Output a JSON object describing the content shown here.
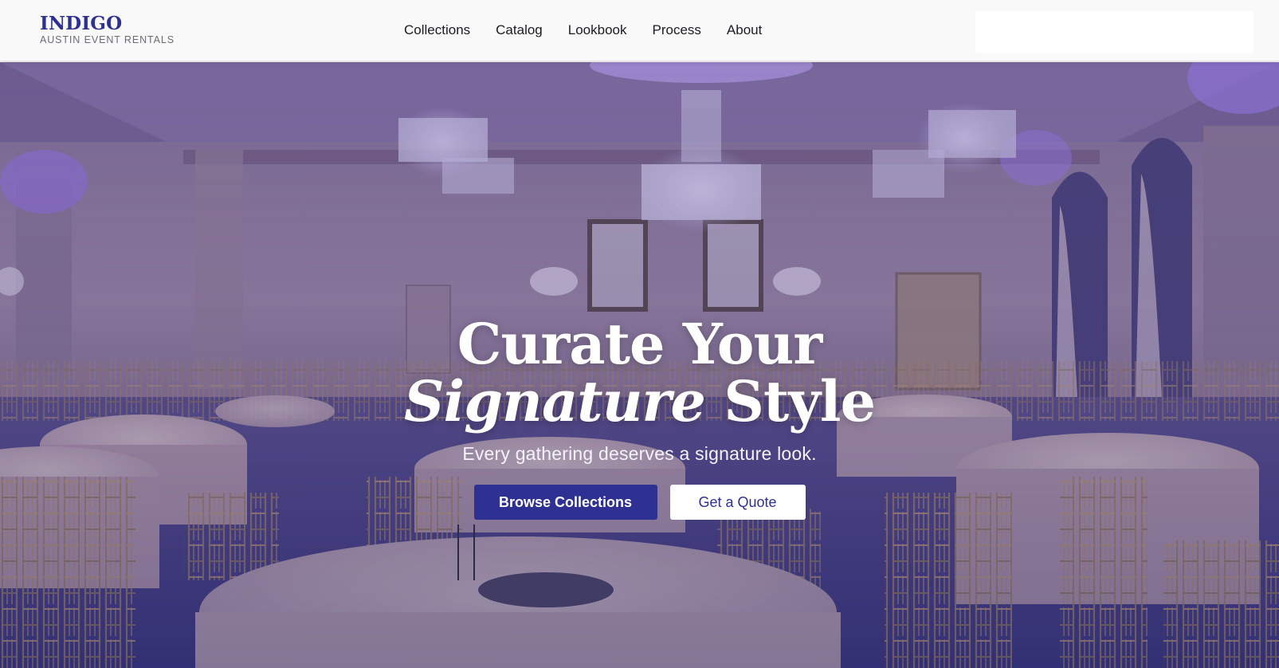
{
  "brand": {
    "name": "INDIGO",
    "tagline": "AUSTIN EVENT RENTALS",
    "color": "#2e3192"
  },
  "nav": {
    "items": [
      "Collections",
      "Catalog",
      "Lookbook",
      "Process",
      "About"
    ]
  },
  "hero": {
    "headline_line1": "Curate Your",
    "headline_italic": "Signature",
    "headline_rest": " Style",
    "subheading": "Every gathering deserves a signature look.",
    "primary_cta": "Browse Collections",
    "secondary_cta": "Get a Quote",
    "background": "ballroom with round tables, gold chiavari chairs and crystal chandeliers"
  }
}
